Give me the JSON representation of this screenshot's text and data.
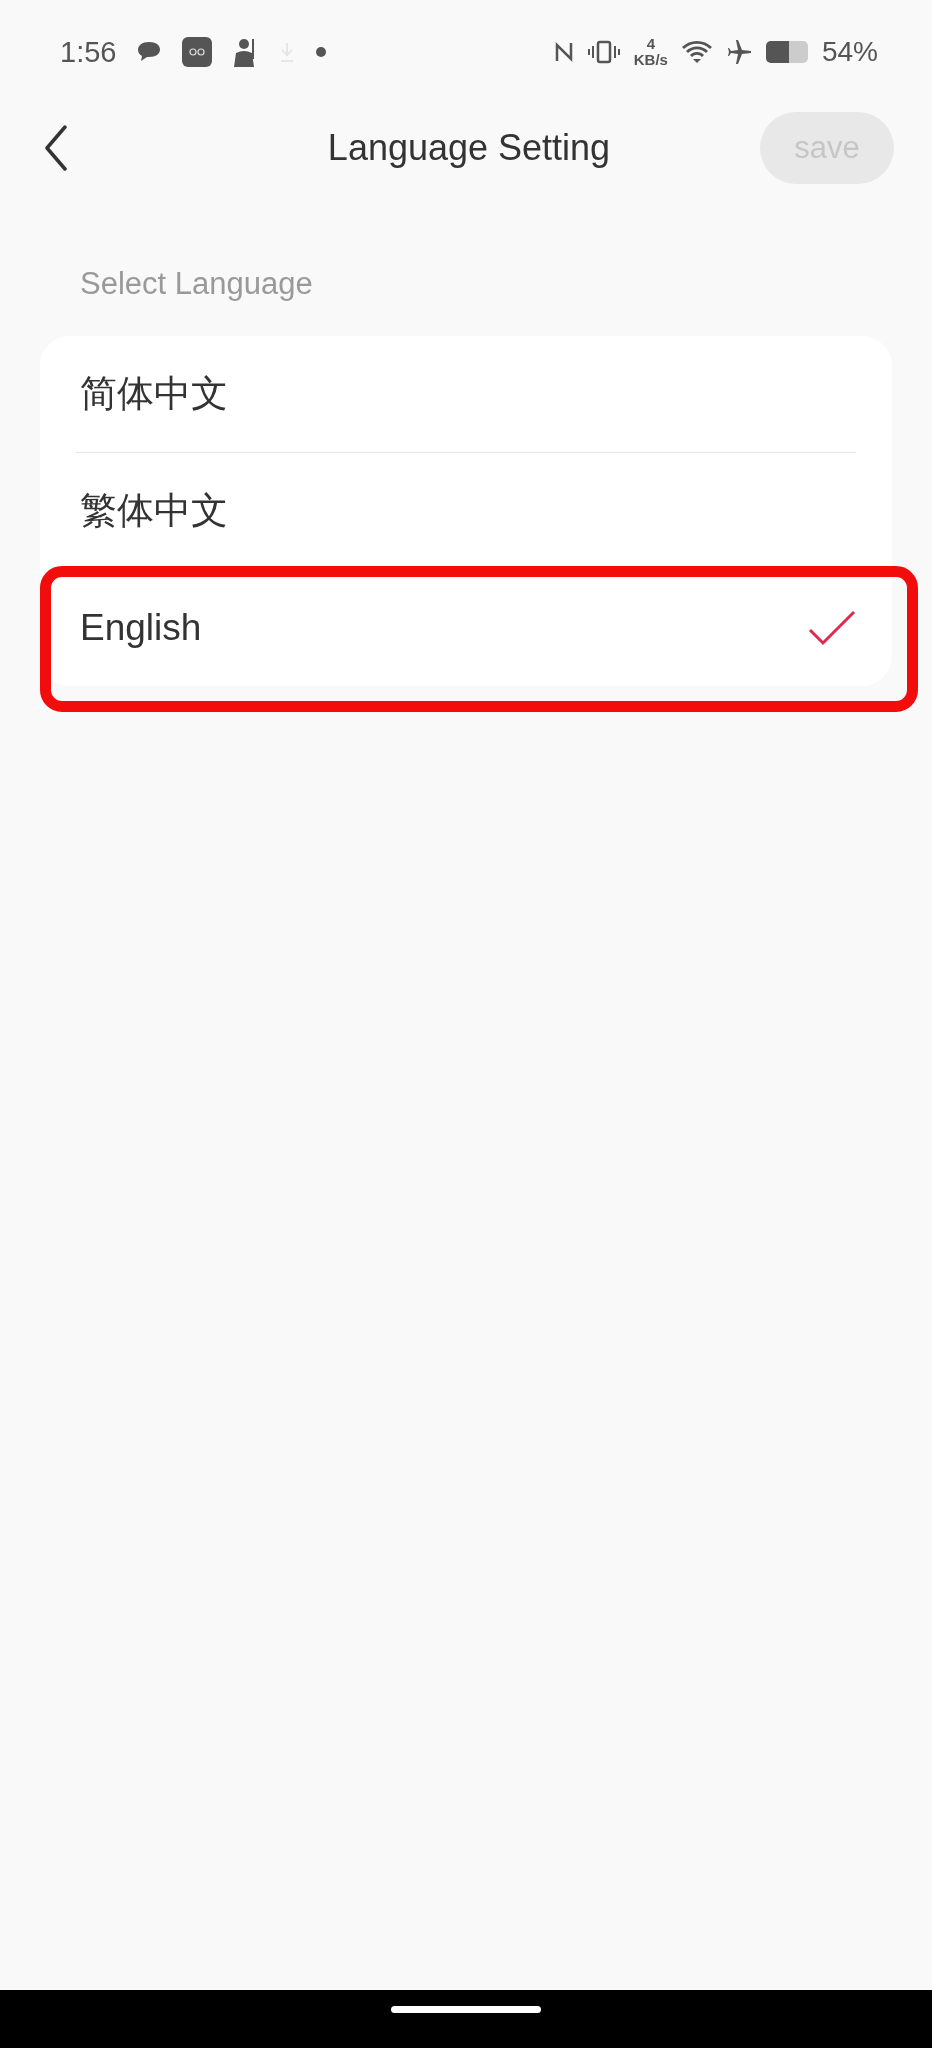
{
  "status_bar": {
    "time": "1:56",
    "net_speed_value": "4",
    "net_speed_unit": "KB/s",
    "battery": "54%"
  },
  "header": {
    "title": "Language Setting",
    "save": {
      "label": "save",
      "disabled": true
    }
  },
  "section_label": "Select Language",
  "languages": [
    {
      "label": "简体中文",
      "selected": false,
      "highlighted": false
    },
    {
      "label": "繁体中文",
      "selected": false,
      "highlighted": false
    },
    {
      "label": "English",
      "selected": true,
      "highlighted": true
    }
  ]
}
